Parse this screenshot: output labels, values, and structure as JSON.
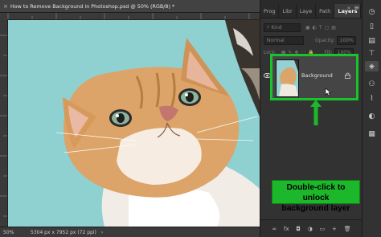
{
  "document": {
    "tab_title": "How to Remove Background in Photoshop.psd @ 50% (RGB/8) *",
    "close_glyph": "×",
    "zoom": "50%",
    "doc_info": "5304 px x 7952 px (72 ppi)",
    "status_arrow": "›"
  },
  "panel": {
    "tabs": [
      {
        "label": "Prog"
      },
      {
        "label": "Libr"
      },
      {
        "label": "Laye"
      },
      {
        "label": "Path"
      },
      {
        "label": "Layers"
      }
    ],
    "collapse_glyph": "»",
    "menu_glyph": "≡",
    "filter_kind": "Kind",
    "blend_mode": "Normal",
    "opacity_label": "Opacity:",
    "opacity_value": "100%",
    "lock_label": "Lock:",
    "fill_label": "Fill:",
    "fill_value": "100%",
    "layer": {
      "name": "Background",
      "visible_glyph": "👁",
      "lock_glyph": "🔒"
    },
    "callout": {
      "line1": "Double-click to unlock",
      "line2": "background layer"
    },
    "bottom_icons": [
      "∞",
      "fx",
      "◘",
      "◑",
      "▭",
      "+",
      "🗑"
    ]
  },
  "colors": {
    "highlight": "#19c42a",
    "canvas_bg": "#8fd0d1",
    "callout_bg": "#1db72b"
  }
}
